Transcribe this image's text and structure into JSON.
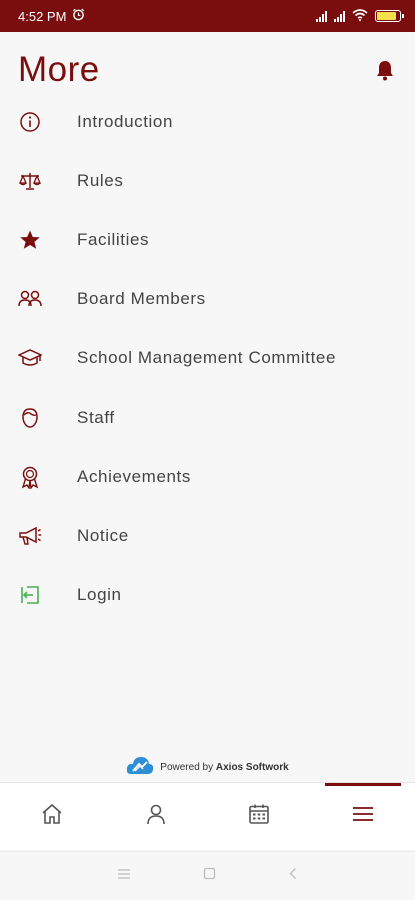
{
  "status_bar": {
    "time": "4:52 PM"
  },
  "header": {
    "title": "More"
  },
  "menu": [
    {
      "label": "Introduction"
    },
    {
      "label": "Rules"
    },
    {
      "label": "Facilities"
    },
    {
      "label": "Board Members"
    },
    {
      "label": "School Management Committee"
    },
    {
      "label": "Staff"
    },
    {
      "label": "Achievements"
    },
    {
      "label": "Notice"
    },
    {
      "label": "Login"
    }
  ],
  "footer": {
    "powered_prefix": "Powered by",
    "company": "Axios Softwork"
  },
  "bottom_nav": [
    {
      "icon": "home-icon"
    },
    {
      "icon": "profile-icon"
    },
    {
      "icon": "calendar-icon"
    },
    {
      "icon": "hamburger-menu-icon",
      "active": true
    }
  ],
  "colors": {
    "brand": "#7a0e0e",
    "login_icon": "#4caf50"
  }
}
